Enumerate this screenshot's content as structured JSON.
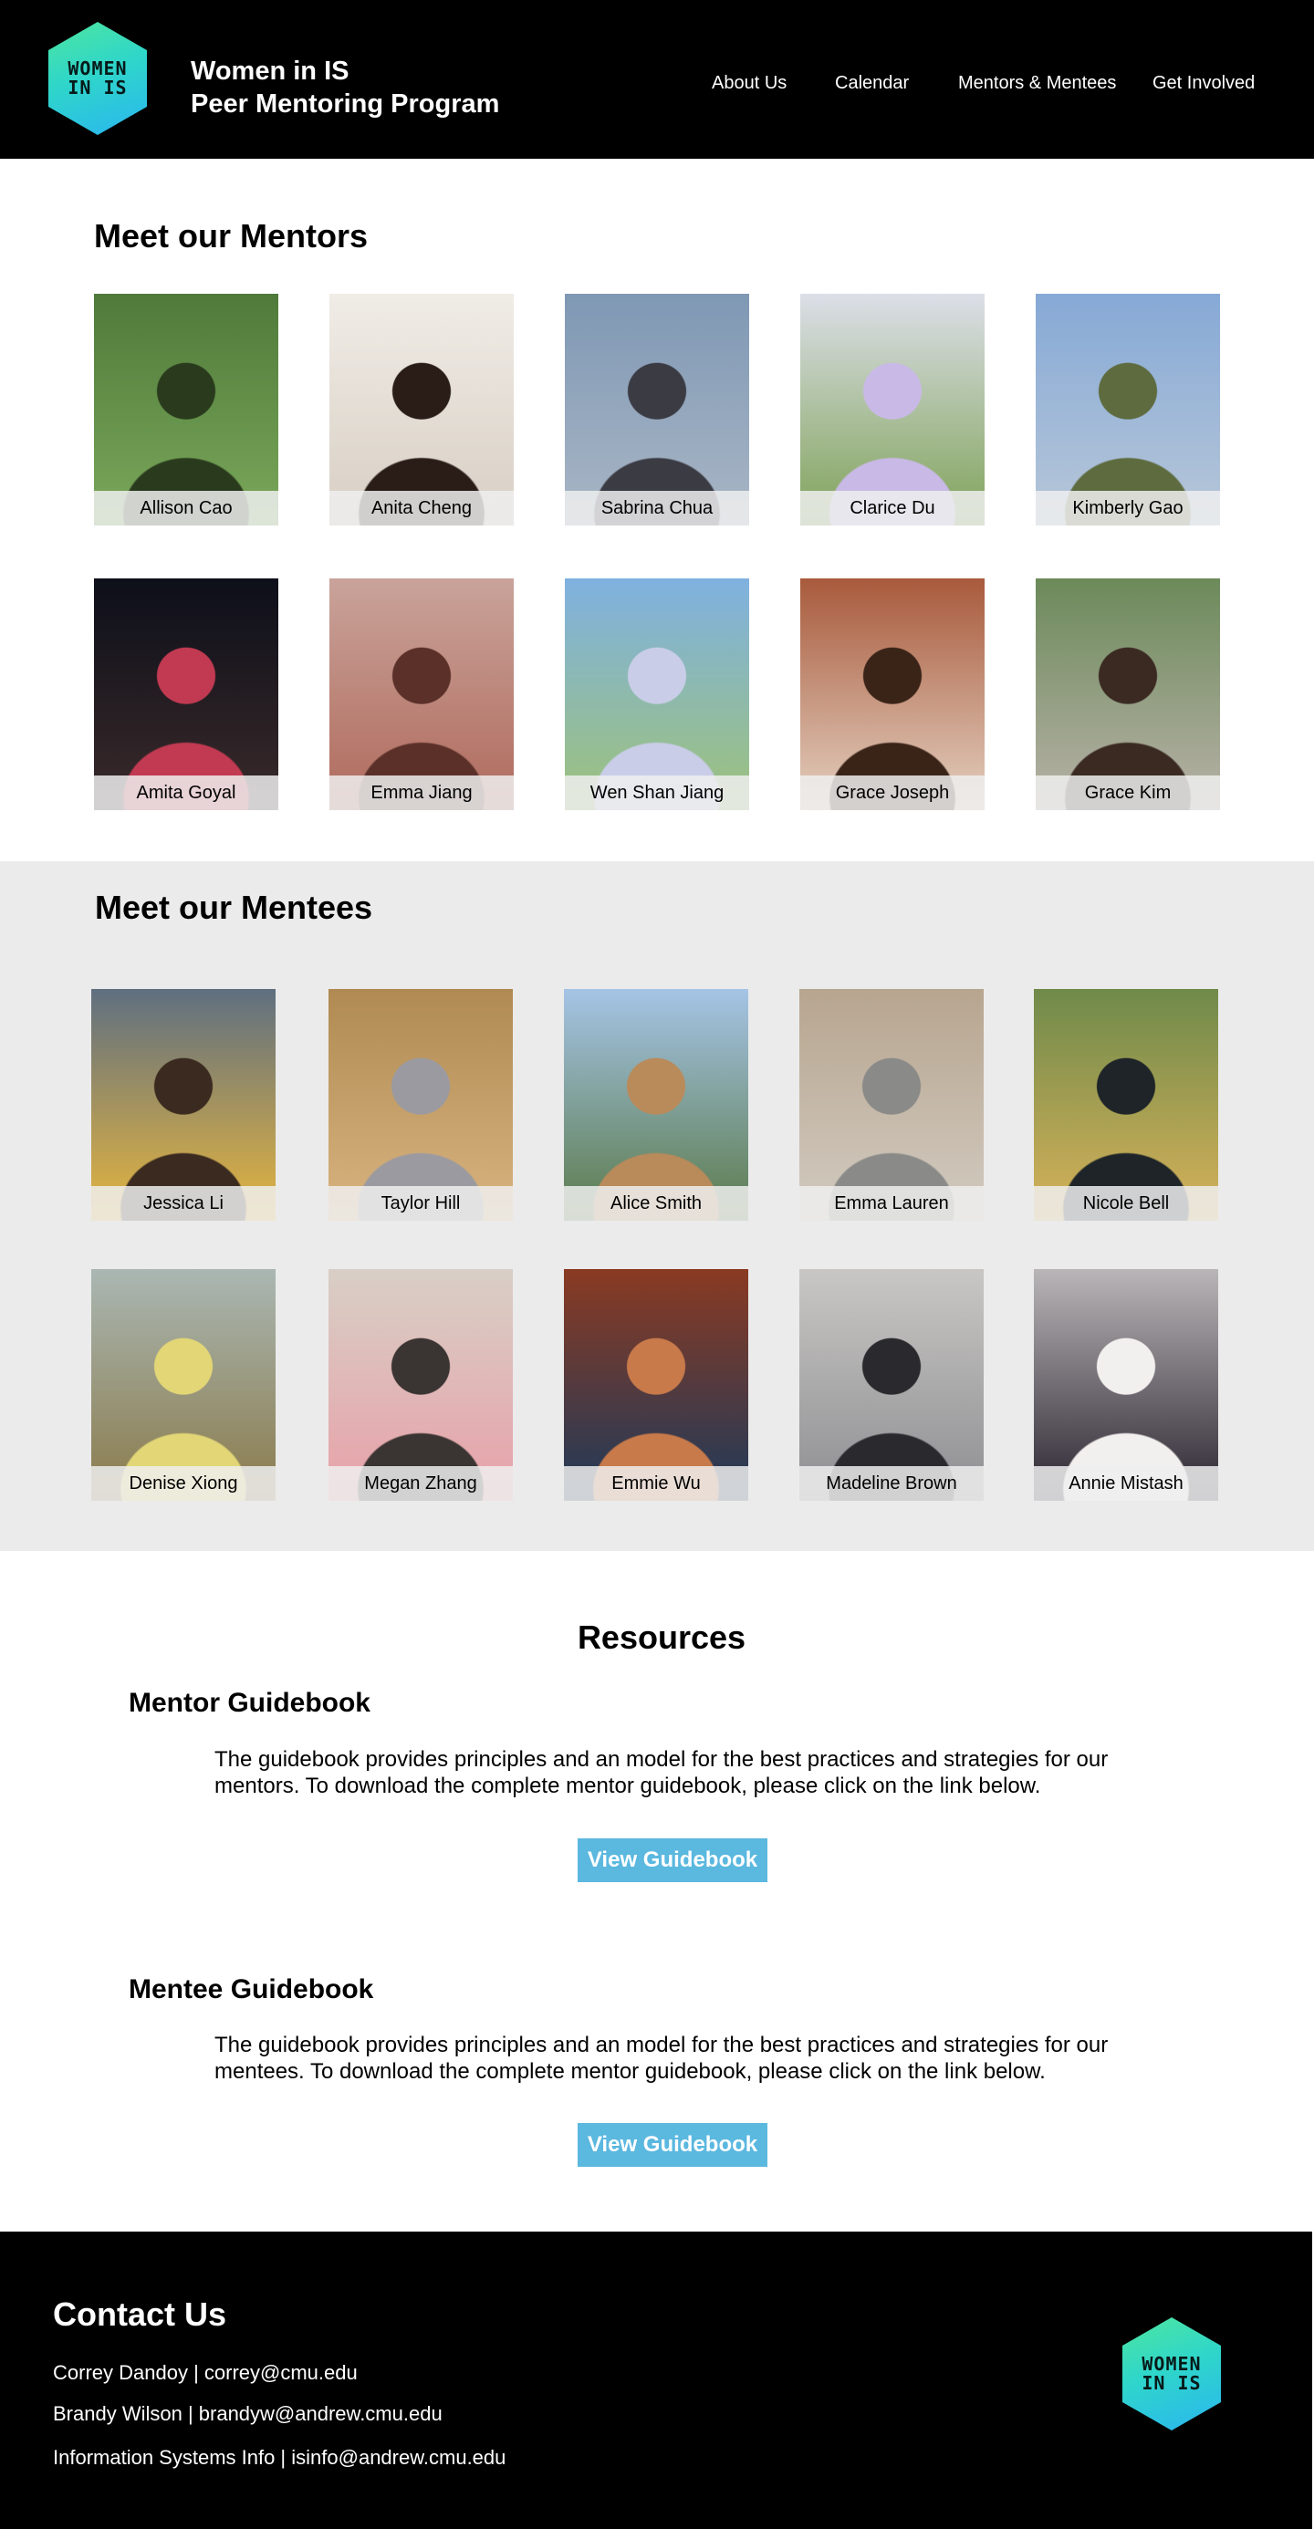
{
  "header": {
    "logo_text_1": "WOMEN",
    "logo_text_2": "IN IS",
    "title_line1": "Women in IS",
    "title_line2": "Peer Mentoring Program",
    "nav": [
      "About Us",
      "Calendar",
      "Mentors & Mentees",
      "Get Involved"
    ]
  },
  "mentors": {
    "title": "Meet our Mentors",
    "people": [
      {
        "name": "Allison Cao",
        "palette": [
          "#4f7a3a",
          "#7aa85a",
          "#2a3b1d"
        ]
      },
      {
        "name": "Anita Cheng",
        "palette": [
          "#f0ece6",
          "#d8cfc4",
          "#2a1d18"
        ]
      },
      {
        "name": "Sabrina Chua",
        "palette": [
          "#7f98b4",
          "#a9b6c5",
          "#3b3b44"
        ]
      },
      {
        "name": "Clarice Du",
        "palette": [
          "#dcdfe8",
          "#7fa258",
          "#c9b9e6"
        ]
      },
      {
        "name": "Kimberly Gao",
        "palette": [
          "#86a9d6",
          "#b7c7d9",
          "#5e6b3f"
        ]
      },
      {
        "name": "Amita Goyal",
        "palette": [
          "#0d0f1a",
          "#3a2a2a",
          "#c23a52"
        ]
      },
      {
        "name": "Emma Jiang",
        "palette": [
          "#c9a39a",
          "#b06a5c",
          "#5a3028"
        ]
      },
      {
        "name": "Wen Shan Jiang",
        "palette": [
          "#7fb1e0",
          "#9dc27a",
          "#c9cde8"
        ]
      },
      {
        "name": "Grace Joseph",
        "palette": [
          "#a85a3c",
          "#e4d0c0",
          "#3a2418"
        ]
      },
      {
        "name": "Grace Kim",
        "palette": [
          "#6c8a5a",
          "#b8b2a8",
          "#3b2a22"
        ]
      }
    ]
  },
  "mentees": {
    "title": "Meet our Mentees",
    "people": [
      {
        "name": "Jessica Li",
        "palette": [
          "#5f6f80",
          "#e7b63e",
          "#3a2a20"
        ]
      },
      {
        "name": "Taylor Hill",
        "palette": [
          "#b08a52",
          "#d9b480",
          "#9a9aa0"
        ]
      },
      {
        "name": "Alice Smith",
        "palette": [
          "#a5c4e6",
          "#5a7a4a",
          "#b98a5a"
        ]
      },
      {
        "name": "Emma Lauren",
        "palette": [
          "#b7a58f",
          "#d2cbc1",
          "#8a8a88"
        ]
      },
      {
        "name": "Nicole Bell",
        "palette": [
          "#6f8a4a",
          "#d8b25a",
          "#1e2428"
        ]
      },
      {
        "name": "Denise Xiong",
        "palette": [
          "#aab7b3",
          "#8a7a4a",
          "#e2d676"
        ]
      },
      {
        "name": "Megan Zhang",
        "palette": [
          "#d8cfc6",
          "#e8a0a8",
          "#3a3432"
        ]
      },
      {
        "name": "Emmie Wu",
        "palette": [
          "#8a3a22",
          "#1e3a5a",
          "#c87a4a"
        ]
      },
      {
        "name": "Madeline Brown",
        "palette": [
          "#c9c7c4",
          "#8e8e92",
          "#2a2a2e"
        ]
      },
      {
        "name": "Annie Mistash",
        "palette": [
          "#b9b6b8",
          "#2b2430",
          "#f2f0ee"
        ]
      }
    ]
  },
  "resources": {
    "title": "Resources",
    "mentor_title": "Mentor Guidebook",
    "mentor_text": "The guidebook provides principles and an model for the best practices and strategies for our mentors. To download the complete mentor guidebook, please click on the link below.",
    "mentor_button": "View Guidebook",
    "mentee_title": "Mentee Guidebook",
    "mentee_text": "The guidebook provides principles and an model for the best practices and strategies for our mentees. To download the complete mentor guidebook, please click on the link below.",
    "mentee_button": "View Guidebook"
  },
  "footer": {
    "title": "Contact Us",
    "lines": [
      "Correy Dandoy | correy@cmu.edu",
      "Brandy Wilson | brandyw@andrew.cmu.edu",
      "Information Systems Info | isinfo@andrew.cmu.edu"
    ],
    "logo_text_1": "WOMEN",
    "logo_text_2": "IN IS"
  }
}
